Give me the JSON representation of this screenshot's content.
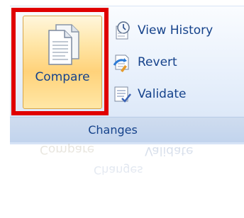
{
  "group": {
    "label": "Changes"
  },
  "compare": {
    "label": "Compare",
    "icon": "documents-icon"
  },
  "buttons": [
    {
      "label": "View History",
      "icon": "history-icon"
    },
    {
      "label": "Revert",
      "icon": "revert-icon"
    },
    {
      "label": "Validate",
      "icon": "validate-icon"
    }
  ],
  "colors": {
    "highlight": "#e00000",
    "label_text": "#15428b",
    "button_hover": "#ffd27a"
  }
}
